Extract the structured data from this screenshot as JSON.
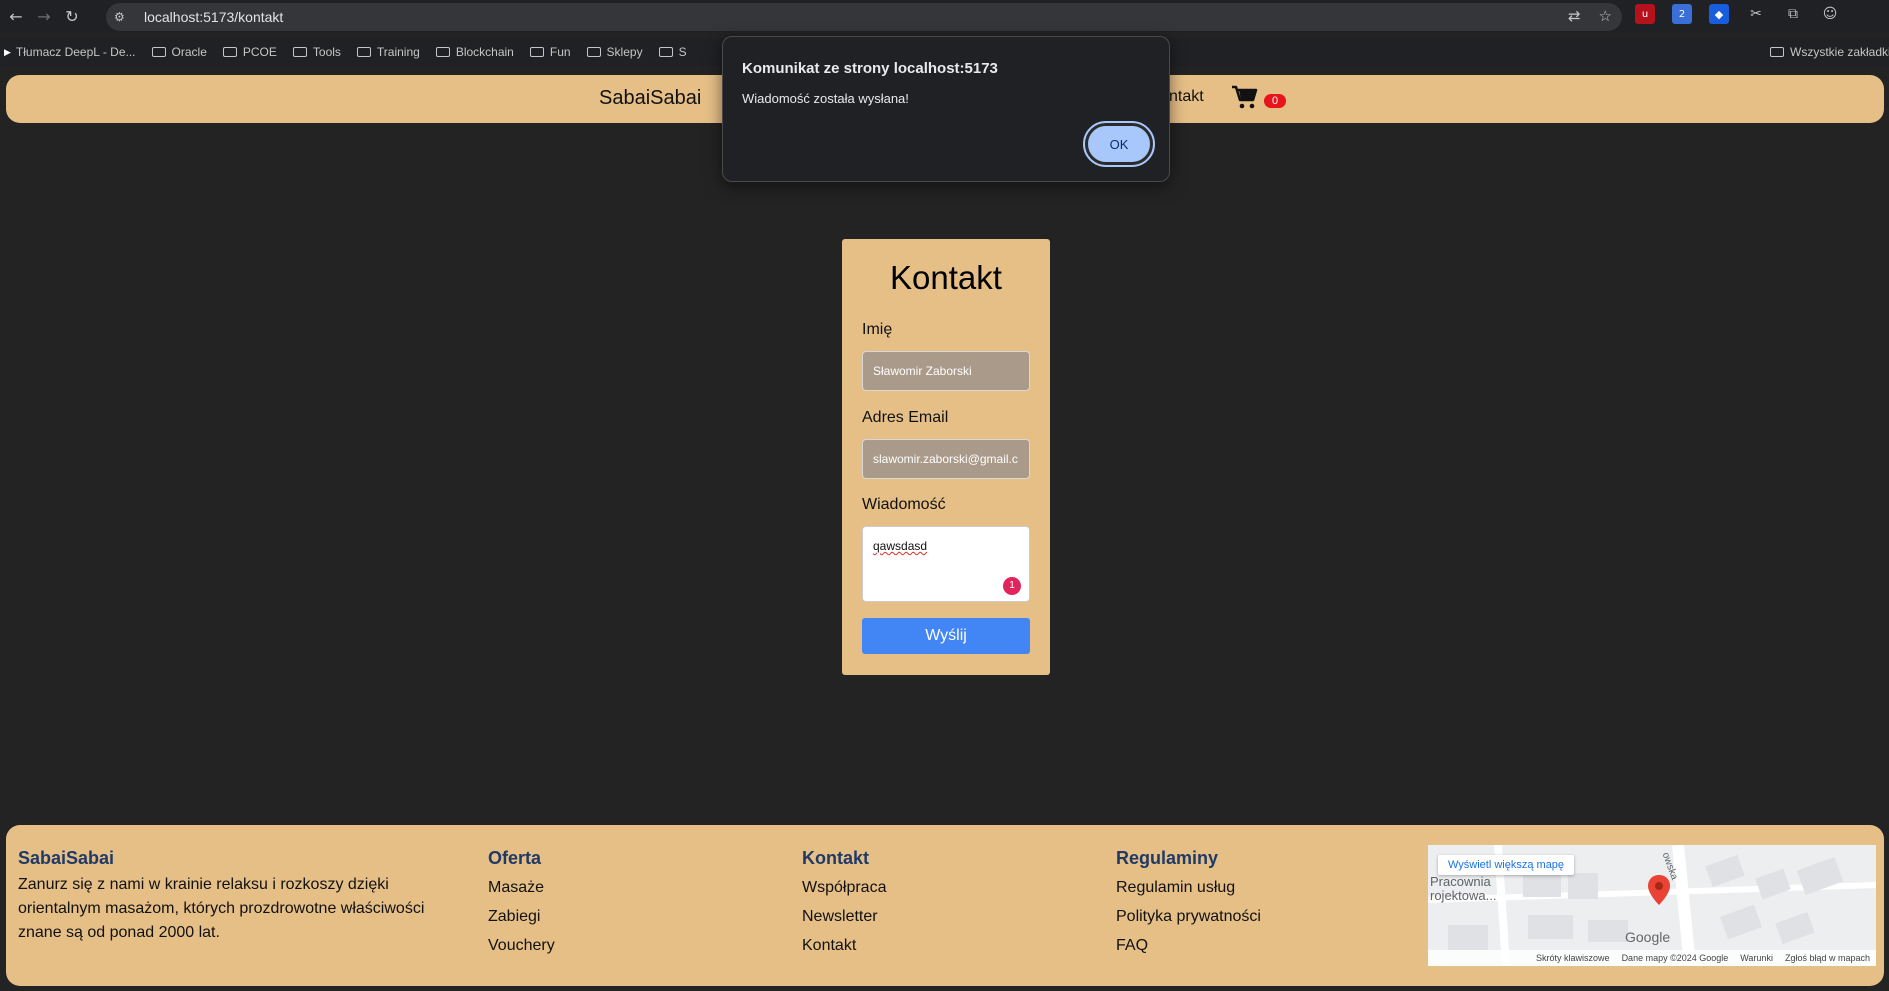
{
  "browser": {
    "url": "localhost:5173/kontakt",
    "bookmarks": [
      "Tłumacz DeepL - De...",
      "Oracle",
      "PCOE",
      "Tools",
      "Training",
      "Blockchain",
      "Fun",
      "Sklepy",
      "S"
    ],
    "all_bookmarks_label": "Wszystkie zakładki"
  },
  "header": {
    "brand": "SabaiSabai",
    "nav_contact": "ntakt",
    "cart_count": "0"
  },
  "dialog": {
    "title": "Komunikat ze strony localhost:5173",
    "message": "Wiadomość została wysłana!",
    "ok_label": "OK"
  },
  "contact_form": {
    "title": "Kontakt",
    "name_label": "Imię",
    "name_value": "Sławomir Zaborski",
    "email_label": "Adres Email",
    "email_value": "slawomir.zaborski@gmail.c",
    "message_label": "Wiadomość",
    "message_value": "qawsdasd",
    "grammarly_count": "1",
    "submit_label": "Wyślij"
  },
  "footer": {
    "about": {
      "title": "SabaiSabai",
      "text": "Zanurz się z nami w krainie relaksu i rozkoszy dzięki orientalnym masażom, których prozdrowotne właściwości znane są od ponad 2000 lat."
    },
    "offer": {
      "title": "Oferta",
      "links": [
        "Masaże",
        "Zabiegi",
        "Vouchery"
      ]
    },
    "contact": {
      "title": "Kontakt",
      "links": [
        "Współpraca",
        "Newsletter",
        "Kontakt"
      ]
    },
    "rules": {
      "title": "Regulaminy",
      "links": [
        "Regulamin usług",
        "Polityka prywatności",
        "FAQ"
      ]
    },
    "map": {
      "view_larger": "Wyświetl większą mapę",
      "place": "Pracownia rojektowa...",
      "street": "owska",
      "logo": "Google",
      "attribution": [
        "Skróty klawiszowe",
        "Dane mapy ©2024 Google",
        "Warunki",
        "Zgłoś błąd w mapach"
      ]
    }
  },
  "colors": {
    "accent": "#e6bf87",
    "page_bg": "#232323",
    "button_blue": "#4285f4",
    "footer_title": "#1f3a66",
    "badge_red": "#e8141c"
  }
}
